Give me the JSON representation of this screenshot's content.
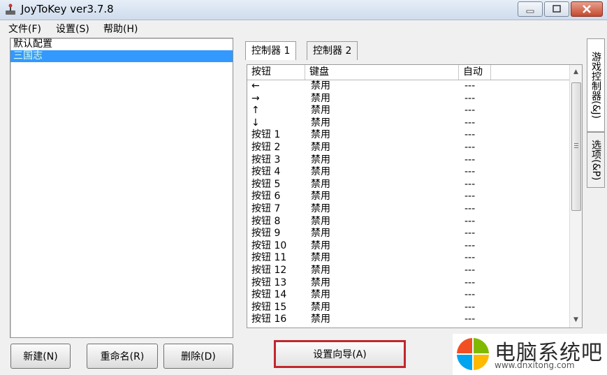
{
  "window": {
    "title": "JoyToKey ver3.7.8"
  },
  "menu": {
    "items": [
      "文件(F)",
      "设置(S)",
      "帮助(H)"
    ]
  },
  "profiles": {
    "items": [
      "默认配置",
      "三国志"
    ],
    "selected_index": 1
  },
  "profile_buttons": {
    "new": "新建(N)",
    "rename": "重命名(R)",
    "delete": "删除(D)"
  },
  "controller_tabs": [
    "控制器 1",
    "控制器 2"
  ],
  "side_tabs": {
    "game_controller": "游戏控制器(&J)",
    "options": "选项(&P)"
  },
  "grid": {
    "headers": [
      "按钮",
      "键盘",
      "自动"
    ],
    "rows": [
      {
        "button": "←",
        "key": "禁用",
        "auto": "---"
      },
      {
        "button": "→",
        "key": "禁用",
        "auto": "---"
      },
      {
        "button": "↑",
        "key": "禁用",
        "auto": "---"
      },
      {
        "button": "↓",
        "key": "禁用",
        "auto": "---"
      },
      {
        "button": "按钮 1",
        "key": "禁用",
        "auto": "---"
      },
      {
        "button": "按钮 2",
        "key": "禁用",
        "auto": "---"
      },
      {
        "button": "按钮 3",
        "key": "禁用",
        "auto": "---"
      },
      {
        "button": "按钮 4",
        "key": "禁用",
        "auto": "---"
      },
      {
        "button": "按钮 5",
        "key": "禁用",
        "auto": "---"
      },
      {
        "button": "按钮 6",
        "key": "禁用",
        "auto": "---"
      },
      {
        "button": "按钮 7",
        "key": "禁用",
        "auto": "---"
      },
      {
        "button": "按钮 8",
        "key": "禁用",
        "auto": "---"
      },
      {
        "button": "按钮 9",
        "key": "禁用",
        "auto": "---"
      },
      {
        "button": "按钮 10",
        "key": "禁用",
        "auto": "---"
      },
      {
        "button": "按钮 11",
        "key": "禁用",
        "auto": "---"
      },
      {
        "button": "按钮 12",
        "key": "禁用",
        "auto": "---"
      },
      {
        "button": "按钮 13",
        "key": "禁用",
        "auto": "---"
      },
      {
        "button": "按钮 14",
        "key": "禁用",
        "auto": "---"
      },
      {
        "button": "按钮 15",
        "key": "禁用",
        "auto": "---"
      },
      {
        "button": "按钮 16",
        "key": "禁用",
        "auto": "---"
      }
    ]
  },
  "wizard_button": "设置向导(A)",
  "watermark": {
    "title": "电脑系统吧",
    "url": "www.dnxitong.com"
  },
  "colors": {
    "selection": "#3399ff",
    "highlight_border": "#c0272d"
  }
}
